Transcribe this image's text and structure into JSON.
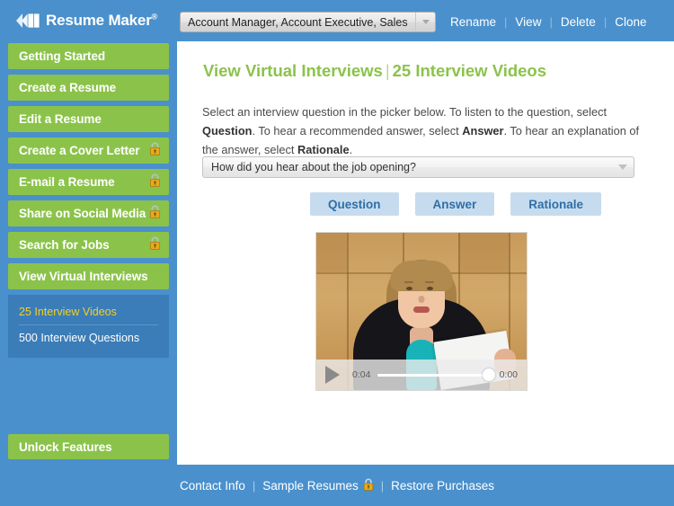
{
  "header": {
    "logo_text": "Resume Maker",
    "logo_registered": "®",
    "profile_value": "Account Manager, Account Executive, Sales",
    "actions": [
      {
        "label": "Rename"
      },
      {
        "label": "View"
      },
      {
        "label": "Delete"
      },
      {
        "label": "Clone"
      }
    ],
    "separator": "|"
  },
  "sidebar": {
    "items": [
      {
        "label": "Getting Started",
        "locked": false,
        "active": false
      },
      {
        "label": "Create a Resume",
        "locked": false,
        "active": false
      },
      {
        "label": "Edit a Resume",
        "locked": false,
        "active": false
      },
      {
        "label": "Create a Cover Letter",
        "locked": true,
        "active": false
      },
      {
        "label": "E-mail a Resume",
        "locked": true,
        "active": false
      },
      {
        "label": "Share on Social Media",
        "locked": true,
        "active": false
      },
      {
        "label": "Search for Jobs",
        "locked": true,
        "active": false
      },
      {
        "label": "View Virtual Interviews",
        "locked": false,
        "active": true
      }
    ],
    "submenu": [
      {
        "label": "25 Interview Videos",
        "active": true
      },
      {
        "label": "500 Interview Questions",
        "active": false
      }
    ],
    "unlock_label": "Unlock Features"
  },
  "main": {
    "title_section": "View Virtual Interviews",
    "title_separator": "|",
    "title_page": "25 Interview Videos",
    "instructions": {
      "part1": "Select an interview question in the picker below. To listen to the question, select ",
      "bold1": "Question",
      "part2": ". To hear a recommended answer, select ",
      "bold2": "Answer",
      "part3": ". To hear an explanation of the answer, select ",
      "bold3": "Rationale",
      "part4": "."
    },
    "question_picker_value": "How did you hear about the job opening?",
    "audio_buttons": [
      {
        "label": "Question"
      },
      {
        "label": "Answer"
      },
      {
        "label": "Rationale"
      }
    ],
    "video": {
      "elapsed_time": "0:04",
      "remaining_time": "0:00"
    }
  },
  "footer": {
    "links": [
      {
        "label": "Contact Info",
        "locked": false
      },
      {
        "label": "Sample Resumes",
        "locked": true
      },
      {
        "label": "Restore Purchases",
        "locked": false
      }
    ],
    "separator": "|"
  },
  "colors": {
    "brand_blue": "#4a90cc",
    "submenu_blue": "#3b7db8",
    "accent_green": "#8bc34a",
    "active_yellow": "#f5d020",
    "button_blue_bg": "#c6dcee",
    "button_blue_text": "#2f6fa8",
    "lock_gold": "#e8a81e"
  }
}
